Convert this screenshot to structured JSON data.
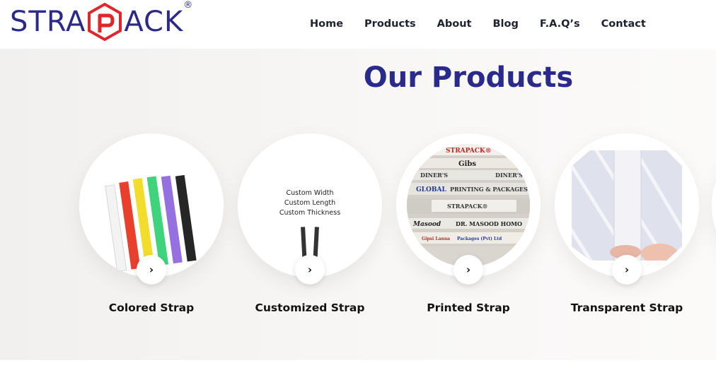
{
  "brand": {
    "logo_left": "STRA",
    "logo_right": "ACK",
    "registered": "®",
    "primary_color": "#2b2a8a",
    "accent_color": "#e0262b"
  },
  "nav": {
    "items": [
      "Home",
      "Products",
      "About",
      "Blog",
      "F.A.Q’s",
      "Contact"
    ]
  },
  "products_section": {
    "title": "Our Products",
    "arrow_glyph": "›",
    "items": [
      {
        "name": "Colored Strap",
        "image": "colored-straps-image"
      },
      {
        "name": "Customized Strap",
        "image": "custom-strap-image",
        "specs": [
          "Custom Width",
          "Custom Length",
          "Custom Thickness"
        ]
      },
      {
        "name": "Printed Strap",
        "image": "printed-straps-image",
        "print_texts": [
          "STRAPACK®",
          "Gibs",
          "DINER'S",
          "DINER'S",
          "GLOBAL",
          "PRINTING & PACKAGES",
          "STRAPACK®",
          "Masood",
          "DR. MASOOD HOMO",
          "Gipsi Lanna",
          "Packages (Pvt) Ltd"
        ]
      },
      {
        "name": "Transparent Strap",
        "image": "transparent-strap-image"
      }
    ]
  }
}
